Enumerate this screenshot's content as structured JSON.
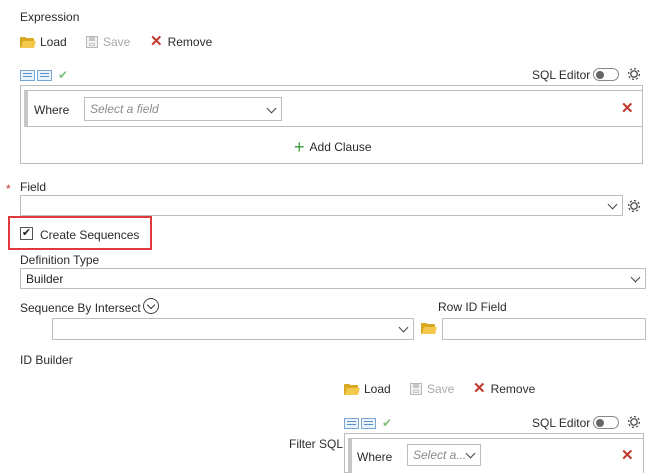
{
  "expression": {
    "title": "Expression",
    "toolbar": {
      "load": "Load",
      "save": "Save",
      "remove": "Remove"
    },
    "sql_editor_label": "SQL Editor",
    "clause": {
      "where_label": "Where",
      "field_placeholder": "Select a field"
    },
    "add_clause": "Add Clause"
  },
  "field": {
    "required_marker": "*",
    "label": "Field",
    "value": ""
  },
  "create_sequences": {
    "label": "Create Sequences",
    "checked": true
  },
  "definition_type": {
    "label": "Definition Type",
    "value": "Builder"
  },
  "sequence_by_intersect": {
    "label": "Sequence By Intersect",
    "value": ""
  },
  "row_id_field": {
    "label": "Row ID Field",
    "value": ""
  },
  "id_builder": {
    "label": "ID Builder",
    "toolbar": {
      "load": "Load",
      "save": "Save",
      "remove": "Remove"
    },
    "sql_editor_label": "SQL Editor",
    "filter_sql_label": "Filter SQL",
    "clause": {
      "where_label": "Where",
      "field_placeholder": "Select a..."
    }
  },
  "colors": {
    "highlight": "#e0393e",
    "add_green": "#3a9a3a",
    "remove_red": "#c0392b",
    "folder": "#f2c94c"
  }
}
